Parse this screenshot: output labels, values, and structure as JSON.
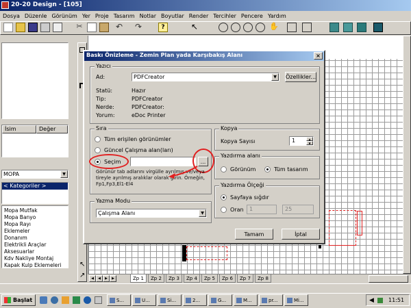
{
  "app": {
    "title": "20-20 Design - [105]"
  },
  "menu": [
    "Dosya",
    "Düzenle",
    "Görünüm",
    "Yer",
    "Proje",
    "Tasarım",
    "Notlar",
    "Boyutlar",
    "Render",
    "Tercihler",
    "Pencere",
    "Yardım"
  ],
  "left_panel": {
    "props_headers": [
      "İsim",
      "Değer"
    ],
    "catalog_value": "MOPA",
    "category_value": "< Kategoriler >",
    "catalog_items": [
      "Mopa Mutfak",
      "Mopa Banyo",
      "Mopa Rayı",
      "Eklemeler",
      "Donanım",
      "Elektrikli Araçlar",
      "Aksesuarlar",
      "Kdv Nakliye Montaj",
      "Kapak Kulp Eklemeleri"
    ]
  },
  "dialog": {
    "title": "Baskı Önizleme - Zemin Plan yada Karşıbakış Alanı",
    "printer": {
      "label": "Yazıcı",
      "name_label": "Ad:",
      "name_value": "PDFCreator",
      "properties_button": "Özellikler...",
      "status_label": "Statü:",
      "status_value": "Hazır",
      "type_label": "Tip:",
      "type_value": "PDFCreator",
      "where_label": "Nerde:",
      "where_value": "PDFCreator:",
      "comment_label": "Yorum:",
      "comment_value": "eDoc Printer"
    },
    "order": {
      "label": "Sıra",
      "all_views": "Tüm erişilen görünümler",
      "current_areas": "Güncel Çalışma alan(ları)",
      "selection": "Seçim",
      "selection_input": "",
      "browse_button": "...",
      "help_text": "Görünür tab adlarını virgülle ayrılmış ve/veya tireyle ayrılmış aralıklar olarak girin. Örneğin, Fp1,Fp3,El1-El4"
    },
    "copy": {
      "label": "Kopya",
      "count_label": "Kopya Sayısı",
      "count_value": "1"
    },
    "print_area": {
      "label": "Yazdırma alanı",
      "view": "Görünüm",
      "full_design": "Tüm tasarım"
    },
    "scale": {
      "label": "Yazdırma Ölçeği",
      "fit_page": "Sayfaya sığdır",
      "ratio": "Oran",
      "ratio_a": "1",
      "ratio_b": "25"
    },
    "write_mode": {
      "label": "Yazma Modu",
      "value": "Çalışma Alanı"
    },
    "ok_button": "Tamam",
    "cancel_button": "İptal"
  },
  "tabs": [
    "Zp 1",
    "Zp 2",
    "Zp 3",
    "Zp 4",
    "Zp 5",
    "Zp 6",
    "Zp 7",
    "Zp 8"
  ],
  "taskbar": {
    "start": "Başlat",
    "items": [
      "S...",
      "U...",
      "Si...",
      "2...",
      "G...",
      "M...",
      "pr...",
      "Mi..."
    ],
    "clock": "11:51"
  },
  "colors": {
    "title_active": "#0a246a",
    "title_gradient": "#a6caf0",
    "annotation": "#e02020",
    "selection": "#0a246a"
  }
}
